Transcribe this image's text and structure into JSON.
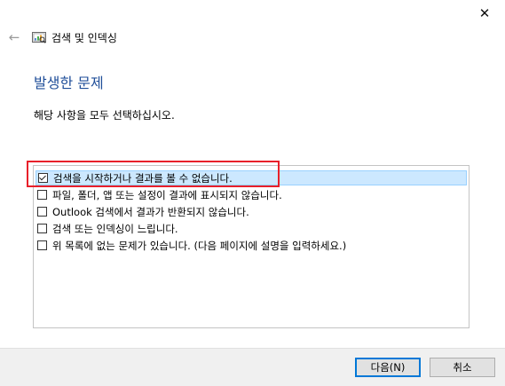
{
  "window": {
    "title": "검색 및 인덱싱",
    "close_glyph": "✕",
    "back_glyph": "←"
  },
  "page": {
    "heading": "발생한 문제",
    "instruction": "해당 사항을 모두 선택하십시오."
  },
  "problems": [
    {
      "label": "검색을 시작하거나 결과를 볼 수 없습니다.",
      "checked": true
    },
    {
      "label": "파일, 폴더, 앱 또는 설정이 결과에 표시되지 않습니다.",
      "checked": false
    },
    {
      "label": "Outlook 검색에서 결과가 반환되지 않습니다.",
      "checked": false
    },
    {
      "label": "검색 또는 인덱싱이 느립니다.",
      "checked": false
    },
    {
      "label": "위 목록에 없는 문제가 있습니다. (다음 페이지에 설명을 입력하세요.)",
      "checked": false
    }
  ],
  "footer": {
    "next_label": "다음(N)",
    "cancel_label": "취소"
  },
  "colors": {
    "heading": "#1f4e99",
    "selection_bg": "#cce8ff",
    "highlight": "#e8202a"
  }
}
